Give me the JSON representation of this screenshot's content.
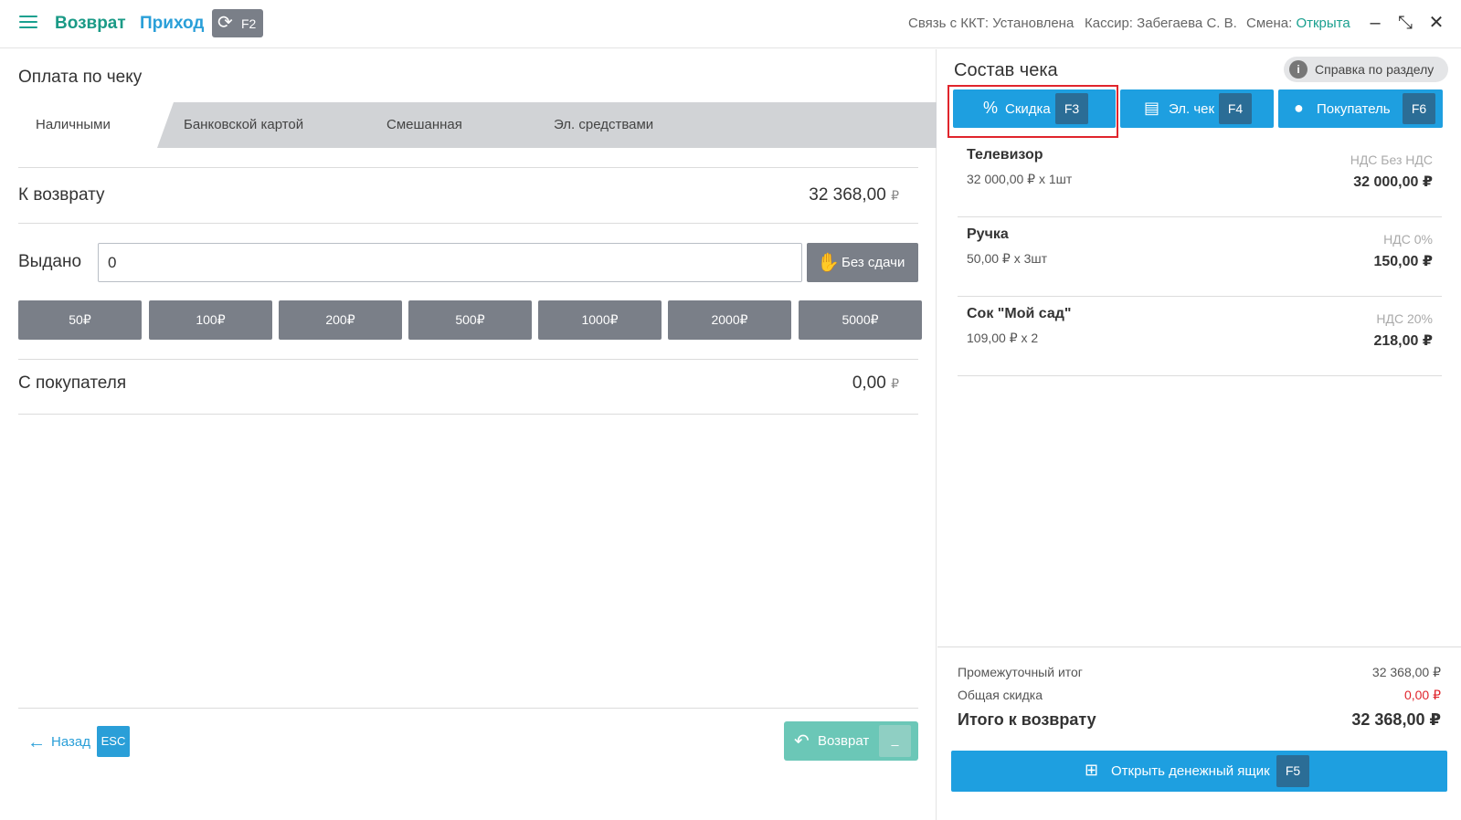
{
  "header": {
    "mode_return": "Возврат",
    "mode_income": "Приход",
    "switch_key": "F2",
    "kkt_status_label": "Связь с ККТ: Установлена",
    "cashier": "Кассир: Забегаева С. В.",
    "shift_label": "Смена:",
    "shift_value": "Открыта",
    "accent": "#1aa08f"
  },
  "payment": {
    "title": "Оплата по чеку",
    "tabs": [
      {
        "label": "Наличными",
        "active": true
      },
      {
        "label": "Банковской картой"
      },
      {
        "label": "Смешанная"
      },
      {
        "label": "Эл. средствами"
      }
    ],
    "to_return_label": "К возврату",
    "to_return_value": "32 368,00",
    "given_label": "Выдано",
    "given_value": "0",
    "no_change_label": "Без сдачи",
    "bills": [
      "50₽",
      "100₽",
      "200₽",
      "500₽",
      "1000₽",
      "2000₽",
      "5000₽"
    ],
    "from_customer_label": "С покупателя",
    "from_customer_value": "0,00",
    "currency": "₽",
    "back_label": "Назад",
    "back_key": "ESC",
    "return_label": "Возврат",
    "return_key": "_"
  },
  "receipt": {
    "title": "Состав чека",
    "help_label": "Справка по разделу",
    "actions": [
      {
        "label": "Скидка",
        "key": "F3",
        "icon": "percent-icon"
      },
      {
        "label": "Эл. чек",
        "key": "F4",
        "icon": "receipt-icon"
      },
      {
        "label": "Покупатель",
        "key": "F6",
        "icon": "user-icon"
      }
    ],
    "items": [
      {
        "name": "Телевизор",
        "qty": "32 000,00 ₽ x 1шт",
        "vat": "НДС Без НДС",
        "sum": "32 000,00 ₽"
      },
      {
        "name": "Ручка",
        "qty": "50,00 ₽ x 3шт",
        "vat": "НДС 0%",
        "sum": "150,00 ₽"
      },
      {
        "name": "Сок \"Мой сад\"",
        "qty": "109,00 ₽ x 2",
        "vat": "НДС 20%",
        "sum": "218,00 ₽"
      }
    ],
    "subtotal_label": "Промежуточный итог",
    "subtotal_value": "32 368,00 ₽",
    "discount_label": "Общая скидка",
    "discount_value": "0,00 ₽",
    "total_label": "Итого к возврату",
    "total_value": "32 368,00 ₽",
    "drawer_label": "Открыть денежный ящик",
    "drawer_key": "F5"
  }
}
